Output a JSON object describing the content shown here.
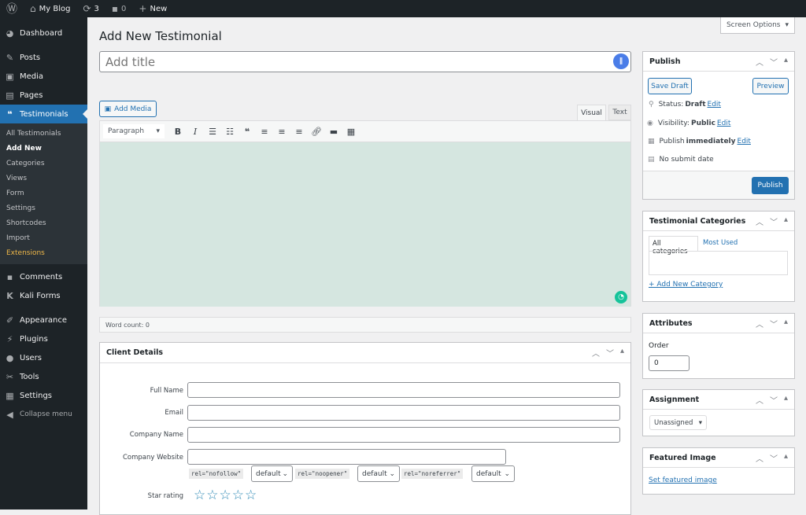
{
  "topbar": {
    "site": "My Blog",
    "updates": "3",
    "comments": "0",
    "new": "New"
  },
  "sidebar": {
    "items": [
      {
        "label": "Dashboard",
        "icon": "dashboard-icon"
      },
      {
        "label": "Posts",
        "icon": "pin-icon"
      },
      {
        "label": "Media",
        "icon": "media-icon"
      },
      {
        "label": "Pages",
        "icon": "pages-icon"
      },
      {
        "label": "Testimonials",
        "icon": "quote-icon"
      }
    ],
    "sub": [
      "All Testimonials",
      "Add New",
      "Categories",
      "Views",
      "Form",
      "Settings",
      "Shortcodes",
      "Import",
      "Extensions"
    ],
    "items2": [
      {
        "label": "Comments"
      },
      {
        "label": "Kali Forms"
      },
      {
        "label": "Appearance"
      },
      {
        "label": "Plugins"
      },
      {
        "label": "Users"
      },
      {
        "label": "Tools"
      },
      {
        "label": "Settings"
      },
      {
        "label": "Collapse menu"
      }
    ]
  },
  "screen_options": "Screen Options",
  "page_title": "Add New Testimonial",
  "title_placeholder": "Add title",
  "editor": {
    "add_media": "Add Media",
    "tab_visual": "Visual",
    "tab_text": "Text",
    "format": "Paragraph",
    "word_count": "Word count: 0",
    "bg_color": "#d5e6e0"
  },
  "client": {
    "title": "Client Details",
    "full_name": "Full Name",
    "email": "Email",
    "company_name": "Company Name",
    "company_website": "Company Website",
    "rel": [
      "rel=\"nofollow\"",
      "rel=\"noopener\"",
      "rel=\"noreferrer\""
    ],
    "rel_value": "default",
    "star_label": "Star rating",
    "stars": 0,
    "stars_max": 5
  },
  "publish": {
    "title": "Publish",
    "save_draft": "Save Draft",
    "preview": "Preview",
    "status_label": "Status:",
    "status": "Draft",
    "visibility_label": "Visibility:",
    "visibility": "Public",
    "publish_label": "Publish",
    "publish_when": "immediately",
    "edit": "Edit",
    "no_submit": "No submit date",
    "publish_btn": "Publish"
  },
  "categories": {
    "title": "Testimonial Categories",
    "tab_all": "All categories",
    "tab_most": "Most Used",
    "add_new": "+ Add New Category"
  },
  "attributes": {
    "title": "Attributes",
    "order_label": "Order",
    "order": "0"
  },
  "assignment": {
    "title": "Assignment",
    "value": "Unassigned"
  },
  "featured": {
    "title": "Featured Image",
    "link": "Set featured image"
  }
}
